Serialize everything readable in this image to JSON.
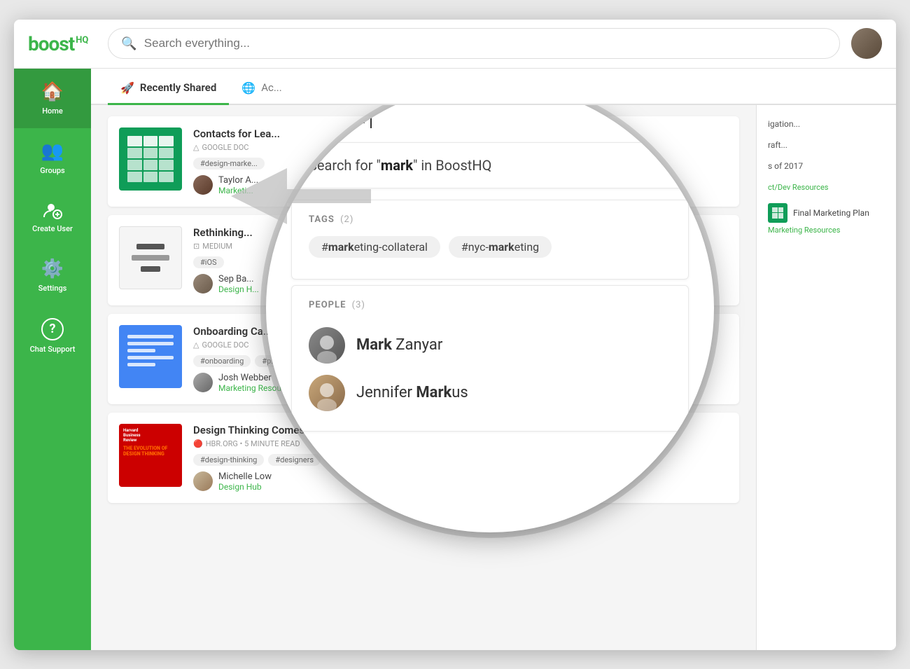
{
  "app": {
    "name": "BoostHQ",
    "logo_text": "boost",
    "logo_hq": "HQ"
  },
  "topbar": {
    "search_placeholder": "Search everything...",
    "search_value": ""
  },
  "sidebar": {
    "items": [
      {
        "id": "home",
        "label": "Home",
        "icon": "🏠",
        "active": true
      },
      {
        "id": "groups",
        "label": "Groups",
        "icon": "👥",
        "active": false
      },
      {
        "id": "create-user",
        "label": "Create User",
        "icon": "👤+",
        "active": false
      },
      {
        "id": "settings",
        "label": "Settings",
        "icon": "⚙️",
        "active": false
      },
      {
        "id": "chat-support",
        "label": "Chat Support",
        "icon": "?",
        "active": false
      }
    ]
  },
  "tabs": [
    {
      "id": "recently-shared",
      "label": "Recently Shared",
      "icon": "🚀",
      "active": true
    },
    {
      "id": "activity",
      "label": "Activity",
      "icon": "🌐",
      "active": false
    }
  ],
  "list_items": [
    {
      "id": "item1",
      "title": "Contacts for Lea...",
      "source_type": "GOOGLE DOC",
      "tags": [
        "#design-marke..."
      ],
      "sharer_name": "Taylor A...",
      "sharer_group": "Marketi...",
      "thumb_type": "sheets"
    },
    {
      "id": "item2",
      "title": "Rethinking...",
      "source_type": "MEDIUM",
      "tags": [
        "#iOS"
      ],
      "sharer_name": "Sep Ba...",
      "sharer_group": "Design H...",
      "thumb_type": "article"
    },
    {
      "id": "item3",
      "title": "Onboarding Ca...",
      "source_type": "GOOGLE DOC",
      "tags": [
        "#onboarding",
        "#p..."
      ],
      "sharer_name": "Josh Webber",
      "sharer_group": "Marketing Resources",
      "thumb_type": "doc"
    },
    {
      "id": "item4",
      "title": "Design Thinking Comes of Age",
      "source_type": "HBR.ORG • 5 MINUTE READ",
      "tags": [
        "#design-thinking",
        "#designers"
      ],
      "sharer_name": "Michelle Low",
      "sharer_group": "Design Hub",
      "thumb_type": "hbr"
    }
  ],
  "right_panel": {
    "items": [
      {
        "text": "igation..."
      },
      {
        "text": "raft..."
      },
      {
        "text": "s of 2017"
      },
      {
        "group": "ct/Dev Resources"
      },
      {
        "text": "Final Marketing Plan",
        "group": "Marketing Resources"
      }
    ]
  },
  "magnifier": {
    "search_value": "mark",
    "search_cursor": "|",
    "suggestion_prefix": "Search for “",
    "suggestion_bold": "mark",
    "suggestion_suffix": "” in BoostHQ",
    "tags_section": {
      "title": "TAGS",
      "count": "(2)",
      "tags": [
        {
          "prefix": "#",
          "bold": "mark",
          "suffix": "eting-collateral",
          "full": "#marketing-collateral"
        },
        {
          "prefix": "#nyc-",
          "bold": "mark",
          "suffix": "eting",
          "full": "#nyc-marketing"
        }
      ]
    },
    "people_section": {
      "title": "PEOPLE",
      "count": "(3)",
      "people": [
        {
          "name_plain": "Mark",
          "name_bold": " Zanyar",
          "avatar_class": "av-mark"
        },
        {
          "name_plain": "Jennifer ",
          "name_bold": "Mark",
          "name_rest": "us",
          "avatar_class": "av-jennifer"
        }
      ]
    }
  }
}
